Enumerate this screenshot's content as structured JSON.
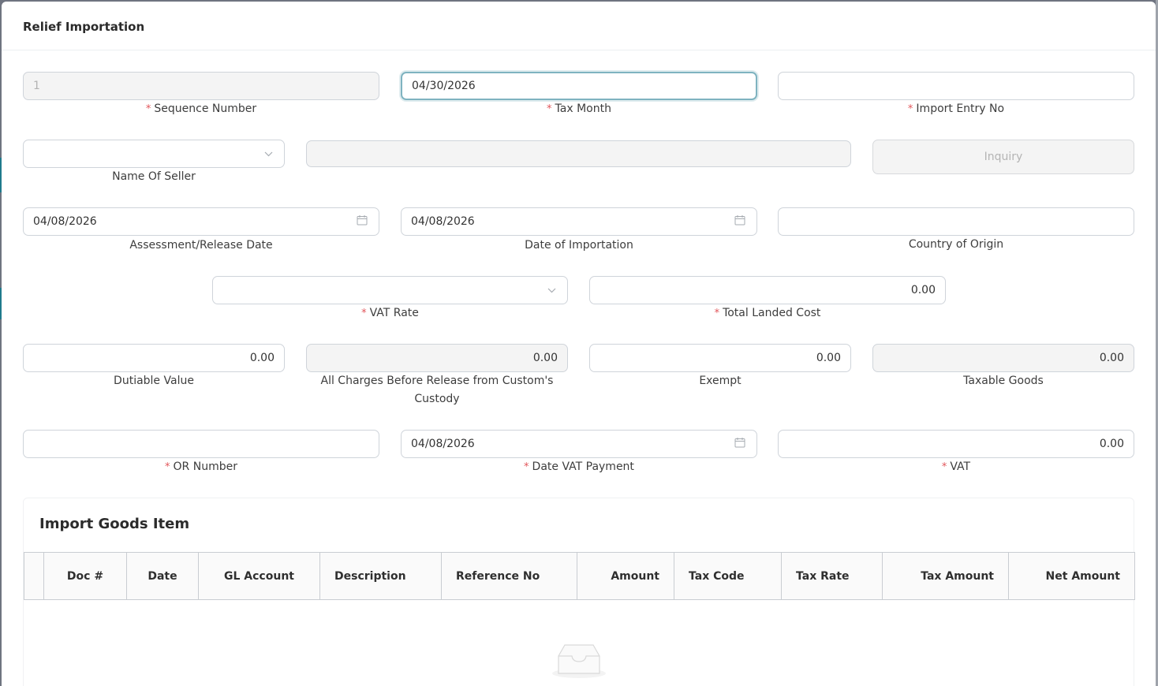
{
  "modal": {
    "title": "Relief Importation"
  },
  "fields": {
    "sequence_number": {
      "value": "1",
      "label": "Sequence Number",
      "required": true
    },
    "tax_month": {
      "value": "04/30/2026",
      "label": "Tax Month",
      "required": true
    },
    "import_entry_no": {
      "value": "",
      "label": "Import Entry No",
      "required": true
    },
    "name_of_seller": {
      "value": "",
      "label": "Name Of Seller"
    },
    "seller_detail": {
      "value": ""
    },
    "inquiry_button": "Inquiry",
    "assessment_release_date": {
      "value": "04/08/2026",
      "label": "Assessment/Release Date"
    },
    "date_of_importation": {
      "value": "04/08/2026",
      "label": "Date of Importation"
    },
    "country_of_origin": {
      "value": "",
      "label": "Country of Origin"
    },
    "vat_rate": {
      "value": "",
      "label": "VAT Rate",
      "required": true
    },
    "total_landed_cost": {
      "value": "0.00",
      "label": "Total Landed Cost",
      "required": true
    },
    "dutiable_value": {
      "value": "0.00",
      "label": "Dutiable Value"
    },
    "all_charges": {
      "value": "0.00",
      "label": "All Charges Before Release from Custom's Custody"
    },
    "exempt": {
      "value": "0.00",
      "label": "Exempt"
    },
    "taxable_goods": {
      "value": "0.00",
      "label": "Taxable Goods"
    },
    "or_number": {
      "value": "",
      "label": "OR Number",
      "required": true
    },
    "date_vat_payment": {
      "value": "04/08/2026",
      "label": "Date VAT Payment",
      "required": true
    },
    "vat": {
      "value": "0.00",
      "label": "VAT",
      "required": true
    }
  },
  "required_mark": "*",
  "import_goods": {
    "title": "Import Goods Item",
    "columns": [
      "Doc #",
      "Date",
      "GL Account",
      "Description",
      "Reference No",
      "Amount",
      "Tax Code",
      "Tax Rate",
      "Tax Amount",
      "Net Amount"
    ]
  },
  "icons": {
    "calendar": "calendar-icon",
    "chevron": "chevron-down-icon",
    "empty": "empty-inbox-icon"
  },
  "colors": {
    "required": "#e2565b",
    "focus_border": "#7fb3c0",
    "accent": "#1f7a8c"
  }
}
